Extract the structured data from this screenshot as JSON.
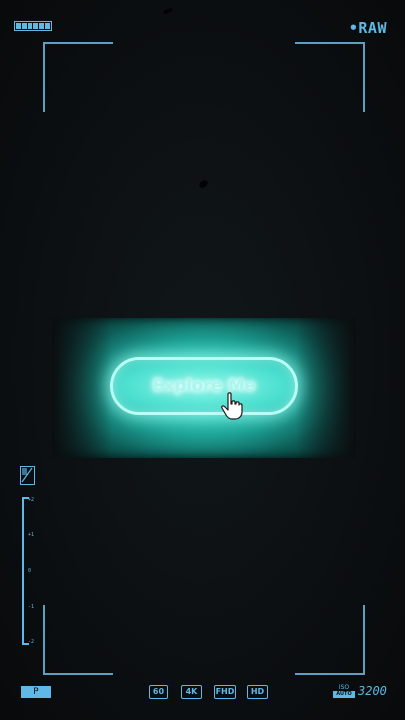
{
  "status": {
    "battery": {
      "level": 1.0,
      "cells": 6
    },
    "format": "•RAW"
  },
  "center": {
    "button_label": "Explore Me",
    "cursor_icon": "hand-pointer-icon"
  },
  "exposure": {
    "icon": "exposure-icon",
    "ticks": [
      "+2",
      "+1",
      "0",
      "-1",
      "-2"
    ]
  },
  "bottom_bar": {
    "mode": "P",
    "specs": [
      "60",
      "4K",
      "FHD",
      "HD"
    ],
    "iso_label": "ISO",
    "iso_auto": "AUTO",
    "iso_value": "3200"
  },
  "colors": {
    "accent": "#5fb8e6",
    "glow": "#3fd8c8",
    "background": "#0b0e10"
  }
}
